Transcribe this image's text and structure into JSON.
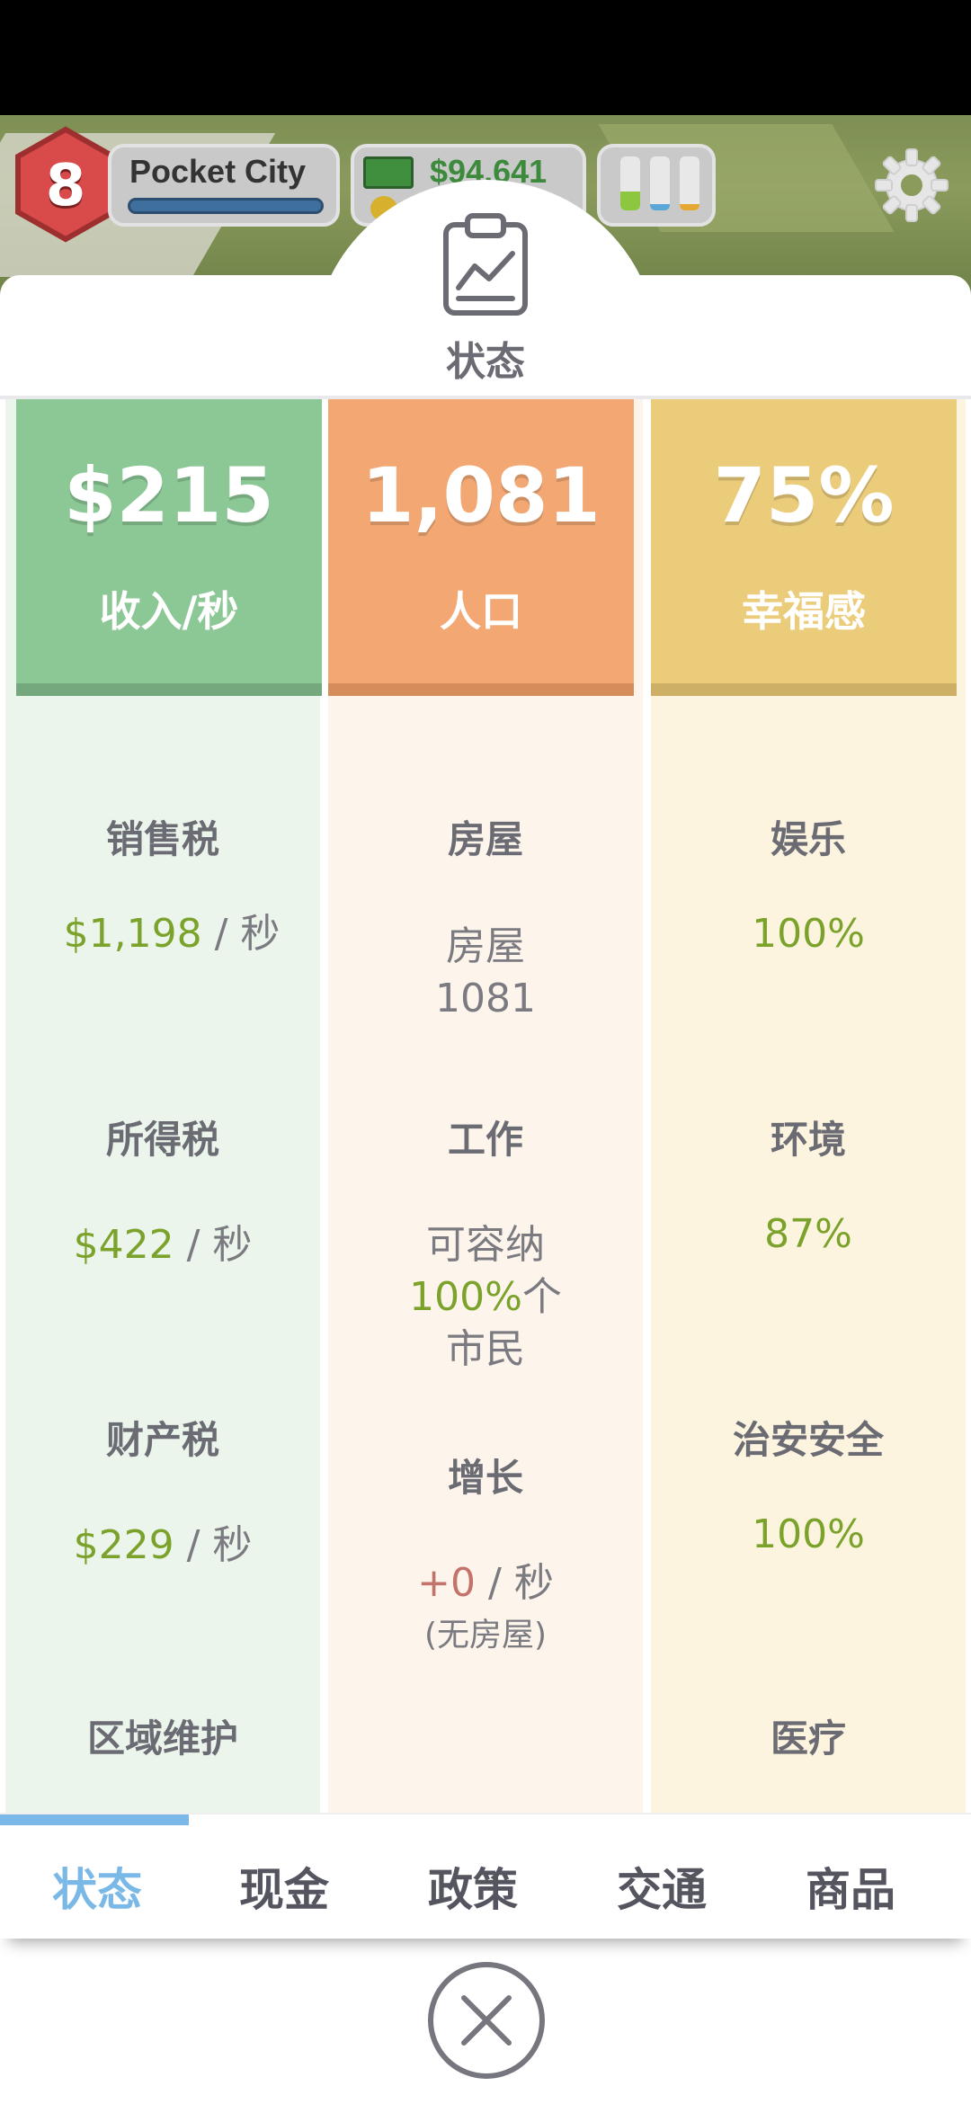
{
  "hud": {
    "level": "8",
    "city_name": "Pocket City",
    "money": "$94,641",
    "colors": {
      "level_badge": "#d94a4a",
      "money_text": "#3d8a3d"
    },
    "demand_bars": [
      {
        "color": "#8dc63f",
        "level": 0.35
      },
      {
        "color": "#5aa7d8",
        "level": 0.12
      },
      {
        "color": "#e5a832",
        "level": 0.12
      }
    ]
  },
  "panel": {
    "icon": "clipboard-chart-icon",
    "title": "状态"
  },
  "columns": {
    "income": {
      "value": "$215",
      "label": "收入/秒",
      "color": "#8cc796",
      "items": [
        {
          "title": "销售税",
          "amount": "$1,198",
          "unit": " / 秒"
        },
        {
          "title": "所得税",
          "amount": "$422",
          "unit": " / 秒"
        },
        {
          "title": "财产税",
          "amount": "$229",
          "unit": " / 秒"
        },
        {
          "title": "区域维护"
        }
      ]
    },
    "population": {
      "value": "1,081",
      "label": "人口",
      "color": "#f3a874",
      "items": [
        {
          "title": "房屋",
          "line1": "房屋",
          "line2": "1081"
        },
        {
          "title": "工作",
          "line1": "可容纳",
          "pct": "100%",
          "line2_suffix": "个",
          "line3": "市民"
        },
        {
          "title": "增长",
          "amount": "+0",
          "unit": " / 秒",
          "note": "(无房屋)"
        }
      ]
    },
    "happiness": {
      "value": "75%",
      "label": "幸福感",
      "color": "#ebcc7b",
      "items": [
        {
          "title": "娱乐",
          "value": "100%"
        },
        {
          "title": "环境",
          "value": "87%"
        },
        {
          "title": "治安安全",
          "value": "100%"
        },
        {
          "title": "医疗"
        }
      ]
    }
  },
  "tabs": [
    {
      "label": "状态",
      "active": true
    },
    {
      "label": "现金",
      "active": false
    },
    {
      "label": "政策",
      "active": false
    },
    {
      "label": "交通",
      "active": false
    },
    {
      "label": "商品",
      "active": false
    }
  ],
  "close_icon": "close-circle-icon"
}
